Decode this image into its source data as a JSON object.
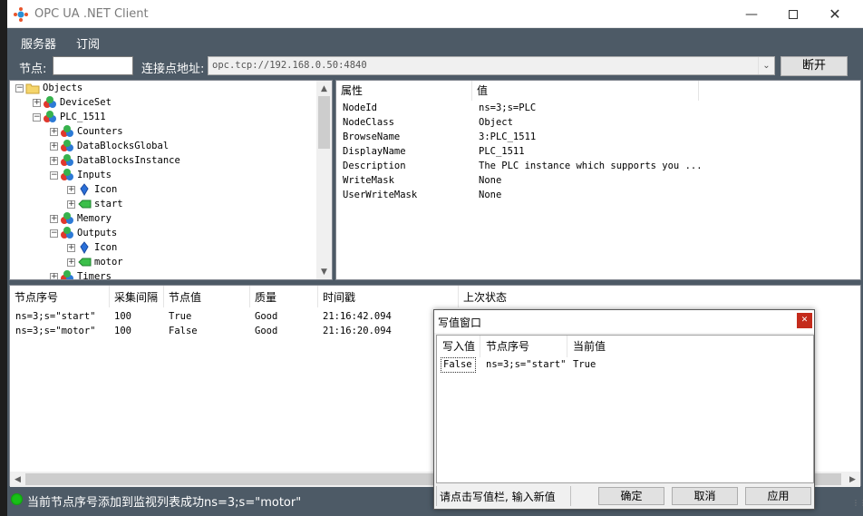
{
  "window": {
    "title": "OPC UA .NET Client"
  },
  "menu": {
    "items": [
      "服务器",
      "订阅"
    ]
  },
  "toolbar": {
    "node_label": "节点:",
    "node_value": "",
    "endpoint_label": "连接点地址:",
    "endpoint_value": "opc.tcp://192.168.0.50:4840",
    "disconnect_label": "断开"
  },
  "tree": {
    "items": [
      {
        "label": "Objects",
        "icon": "folder-icon",
        "expander": "−"
      },
      {
        "label": "DeviceSet",
        "icon": "object-icon",
        "expander": "+"
      },
      {
        "label": "PLC_1511",
        "icon": "object-icon",
        "expander": "−"
      },
      {
        "label": "Counters",
        "icon": "object-icon",
        "expander": "+"
      },
      {
        "label": "DataBlocksGlobal",
        "icon": "object-icon",
        "expander": "+"
      },
      {
        "label": "DataBlocksInstance",
        "icon": "object-icon",
        "expander": "+"
      },
      {
        "label": "Inputs",
        "icon": "object-icon",
        "expander": "−"
      },
      {
        "label": "Icon",
        "icon": "property-icon",
        "expander": "+"
      },
      {
        "label": "start",
        "icon": "variable-icon",
        "expander": "+"
      },
      {
        "label": "Memory",
        "icon": "object-icon",
        "expander": "+"
      },
      {
        "label": "Outputs",
        "icon": "object-icon",
        "expander": "−"
      },
      {
        "label": "Icon",
        "icon": "property-icon",
        "expander": "+"
      },
      {
        "label": "motor",
        "icon": "variable-icon",
        "expander": "+"
      },
      {
        "label": "Timers",
        "icon": "object-icon",
        "expander": "+"
      }
    ]
  },
  "properties": {
    "headers": [
      "属性",
      "值"
    ],
    "rows": [
      {
        "name": "NodeId",
        "value": "ns=3;s=PLC"
      },
      {
        "name": "NodeClass",
        "value": "Object"
      },
      {
        "name": "BrowseName",
        "value": "3:PLC_1511"
      },
      {
        "name": "DisplayName",
        "value": "PLC_1511"
      },
      {
        "name": "Description",
        "value": "The PLC instance which supports you ..."
      },
      {
        "name": "WriteMask",
        "value": "None"
      },
      {
        "name": "UserWriteMask",
        "value": "None"
      }
    ]
  },
  "monitor": {
    "headers": [
      "节点序号",
      "采集间隔",
      "节点值",
      "质量",
      "时间戳",
      "上次状态"
    ],
    "rows": [
      {
        "node": "ns=3;s=\"start\"",
        "interval": "100",
        "value": "True",
        "quality": "Good",
        "timestamp": "21:16:42.094",
        "last": ""
      },
      {
        "node": "ns=3;s=\"motor\"",
        "interval": "100",
        "value": "False",
        "quality": "Good",
        "timestamp": "21:16:20.094",
        "last": ""
      }
    ]
  },
  "status": {
    "text": "当前节点序号添加到监视列表成功ns=3;s=\"motor\"",
    "led_color": "#18c018"
  },
  "dialog": {
    "title": "写值窗口",
    "headers": [
      "写入值",
      "节点序号",
      "当前值"
    ],
    "row": {
      "write": "False",
      "node": "ns=3;s=\"start\"",
      "current": "True"
    },
    "hint": "请点击写值栏, 输入新值",
    "ok_label": "确定",
    "cancel_label": "取消",
    "apply_label": "应用"
  }
}
